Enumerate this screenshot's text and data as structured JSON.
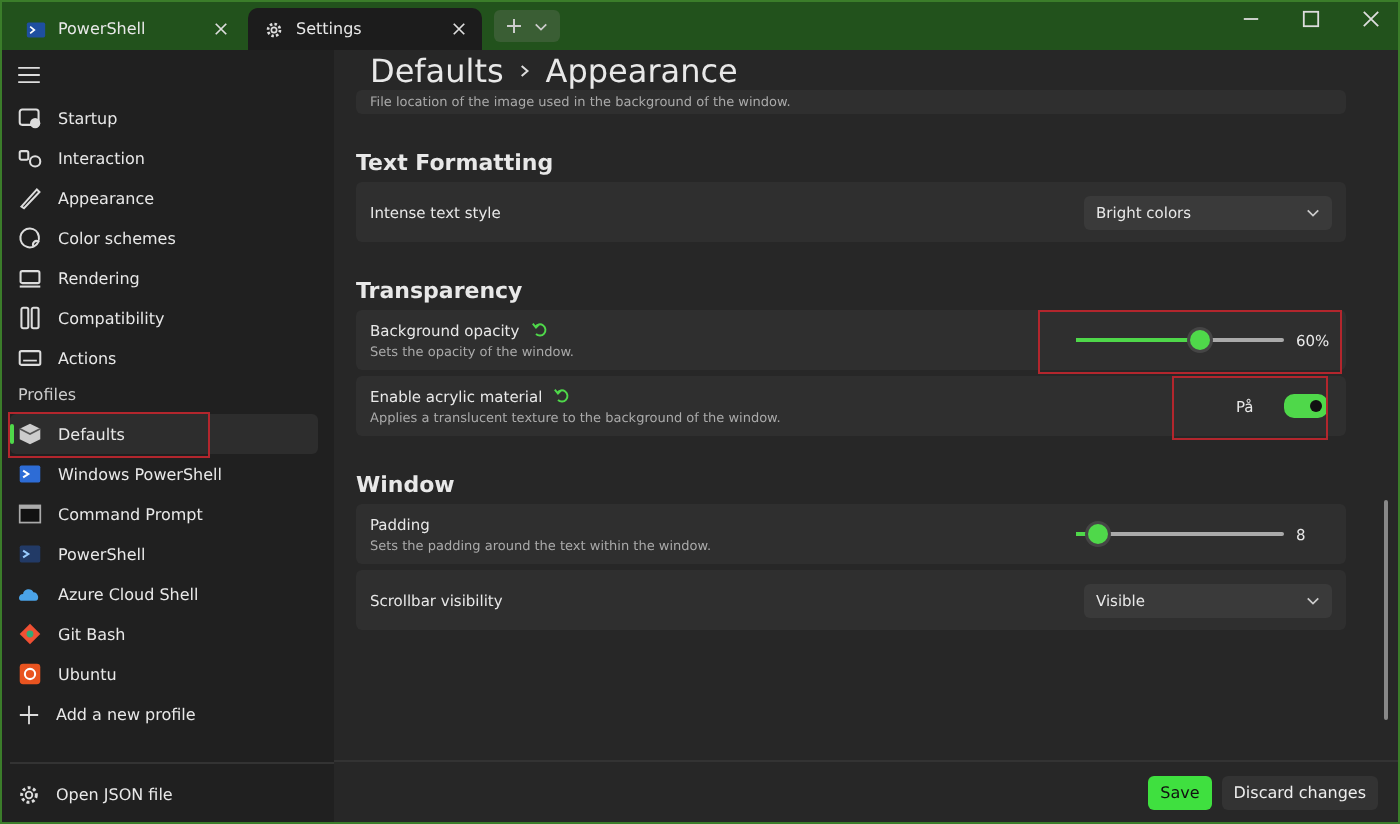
{
  "title_bar": {
    "tabs": [
      {
        "label": "PowerShell",
        "selected": false
      },
      {
        "label": "Settings",
        "selected": true
      }
    ]
  },
  "sidebar": {
    "nav_items": [
      {
        "label": "Startup",
        "selected": false
      },
      {
        "label": "Interaction",
        "selected": false
      },
      {
        "label": "Appearance",
        "selected": false
      },
      {
        "label": "Color schemes",
        "selected": false
      },
      {
        "label": "Rendering",
        "selected": false
      },
      {
        "label": "Compatibility",
        "selected": false
      },
      {
        "label": "Actions",
        "selected": false
      }
    ],
    "section_label": "Profiles",
    "profiles": [
      {
        "label": "Defaults",
        "selected": true,
        "highlighted": true
      },
      {
        "label": "Windows PowerShell",
        "selected": false,
        "highlighted": false
      },
      {
        "label": "Command Prompt",
        "selected": false,
        "highlighted": false
      },
      {
        "label": "PowerShell",
        "selected": false,
        "highlighted": false
      },
      {
        "label": "Azure Cloud Shell",
        "selected": false,
        "highlighted": false
      },
      {
        "label": "Git Bash",
        "selected": false,
        "highlighted": false
      },
      {
        "label": "Ubuntu",
        "selected": false,
        "highlighted": false
      }
    ],
    "add_profile": "Add a new profile",
    "open_json": "Open JSON file"
  },
  "main": {
    "breadcrumb": [
      "Defaults",
      "Appearance"
    ],
    "top_card_description": "File location of the image used in the background of the window.",
    "sections": [
      {
        "title": "Text Formatting",
        "settings": [
          {
            "kind": "dropdown",
            "label": "Intense text style",
            "value": "Bright colors"
          }
        ]
      },
      {
        "title": "Transparency",
        "settings": [
          {
            "kind": "slider",
            "label": "Background opacity",
            "description": "Sets the opacity of the window.",
            "reset": true,
            "level": 0.6,
            "reading": "60%",
            "highlighted": true
          },
          {
            "kind": "toggle",
            "label": "Enable acrylic material",
            "description": "Applies a translucent texture to the background of the window.",
            "reset": true,
            "on": true,
            "state_label": "På",
            "highlighted": true
          }
        ]
      },
      {
        "title": "Window",
        "settings": [
          {
            "kind": "slider",
            "label": "Padding",
            "description": "Sets the padding around the text within the window.",
            "reset": false,
            "level": 0.11,
            "reading": "8",
            "highlighted": false
          },
          {
            "kind": "dropdown",
            "label": "Scrollbar visibility",
            "value": "Visible"
          }
        ]
      }
    ],
    "buttons": [
      {
        "label": "Save",
        "kind": "primary"
      },
      {
        "label": "Discard changes",
        "kind": "secondary"
      }
    ]
  }
}
